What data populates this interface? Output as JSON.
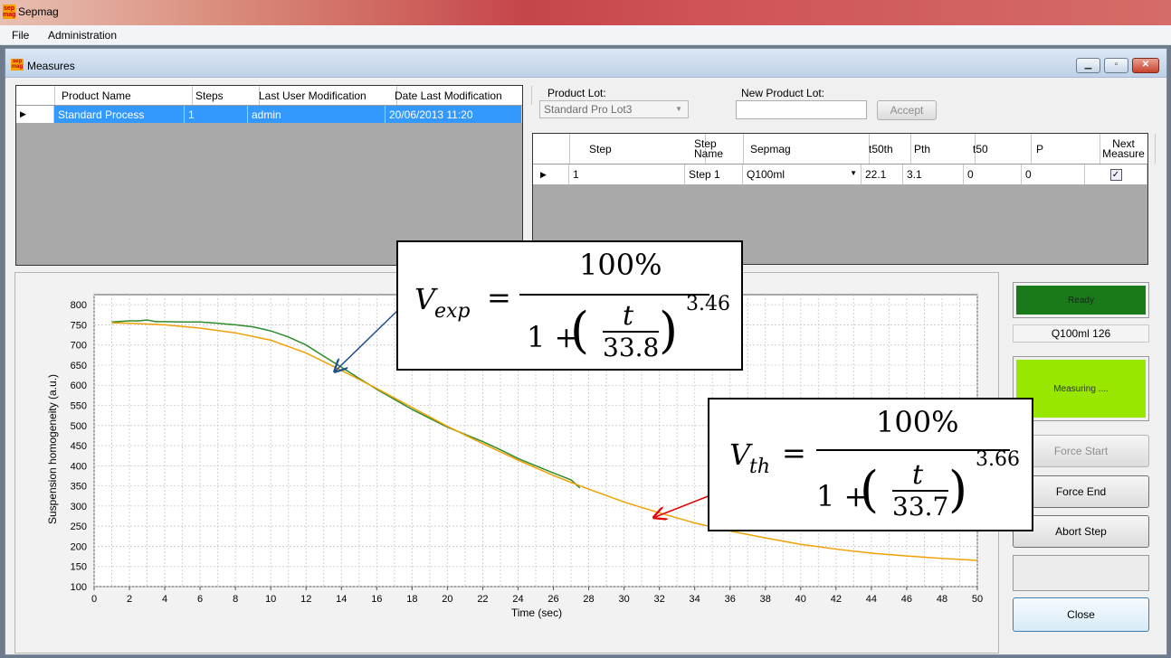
{
  "app": {
    "title": "Sepmag"
  },
  "menu": [
    {
      "label": "File"
    },
    {
      "label": "Administration"
    }
  ],
  "child_window": {
    "title": "Measures"
  },
  "product_table": {
    "columns": [
      "Product Name",
      "Steps",
      "Last User Modification",
      "Date Last Modification"
    ],
    "rows": [
      {
        "product_name": "Standard Process",
        "steps": "1",
        "last_user": "admin",
        "date": "20/06/2013 11:20"
      }
    ]
  },
  "product_lot": {
    "label": "Product Lot:",
    "value": "Standard Pro Lot3"
  },
  "new_product_lot": {
    "label": "New Product Lot:",
    "value": ""
  },
  "accept_label": "Accept",
  "step_table": {
    "columns": [
      "Step",
      "Step Name",
      "Sepmag",
      "t50th",
      "Pth",
      "t50",
      "P",
      "Next Measure"
    ],
    "rows": [
      {
        "step": "1",
        "step_name": "Step 1",
        "sepmag": "Q100ml",
        "t50th": "22.1",
        "pth": "3.1",
        "t50": "0",
        "p": "0",
        "next_measure": true
      }
    ]
  },
  "status": {
    "ready": "Ready",
    "device": "Q100ml 126",
    "measuring": "Measuring ...."
  },
  "buttons": {
    "force_start": "Force Start",
    "force_end": "Force End",
    "abort_step": "Abort Step",
    "close": "Close"
  },
  "colors": {
    "ready": "#1a7a1a",
    "measuring": "#99e600",
    "exp_series": "#2e8b2e",
    "th_series": "#f0a000",
    "arrow_exp": "#1f4e8c",
    "arrow_th": "#e00000",
    "selected_row": "#3399ff"
  },
  "chart_data": {
    "type": "line",
    "xlabel": "Time (sec)",
    "ylabel": "Suspension homogeneity (a.u.)",
    "xlim": [
      0,
      50
    ],
    "ylim": [
      100,
      825
    ],
    "xticks": [
      0,
      2,
      4,
      6,
      8,
      10,
      12,
      14,
      16,
      18,
      20,
      22,
      24,
      26,
      28,
      30,
      32,
      34,
      36,
      38,
      40,
      42,
      44,
      46,
      48,
      50
    ],
    "yticks": [
      100,
      150,
      200,
      250,
      300,
      350,
      400,
      450,
      500,
      550,
      600,
      650,
      700,
      750,
      800
    ],
    "grid": true,
    "series": [
      {
        "x": [
          1,
          2,
          2.5,
          3,
          3.5,
          4,
          5,
          6,
          7,
          8,
          9,
          10,
          11,
          12,
          13,
          14,
          15,
          16,
          17,
          18,
          19,
          20,
          21,
          22,
          23,
          24,
          25,
          26,
          27,
          27.5
        ],
        "y": [
          757,
          760,
          760,
          762,
          758,
          758,
          757,
          757,
          754,
          750,
          745,
          735,
          720,
          700,
          672,
          645,
          617,
          590,
          565,
          540,
          518,
          496,
          478,
          460,
          440,
          418,
          400,
          382,
          365,
          345
        ]
      },
      {
        "x": [
          1,
          2,
          4,
          6,
          8,
          10,
          12,
          14,
          16,
          18,
          20,
          22,
          24,
          26,
          28,
          30,
          32,
          34,
          36,
          38,
          40,
          42,
          44,
          46,
          48,
          50
        ],
        "y": [
          755,
          754,
          750,
          742,
          730,
          712,
          680,
          637,
          592,
          545,
          498,
          455,
          414,
          376,
          342,
          310,
          283,
          258,
          238,
          221,
          205,
          193,
          183,
          176,
          170,
          165
        ]
      }
    ]
  },
  "equation_exp": {
    "lhs": "V",
    "sub": "exp",
    "eq": "=",
    "num": "100%",
    "one": "1 +",
    "t": "t",
    "den": "33.8",
    "exp": "3.46"
  },
  "equation_th": {
    "lhs": "V",
    "sub": "th",
    "eq": "=",
    "num": "100%",
    "one": "1 +",
    "t": "t",
    "den": "33.7",
    "exp": "3.66"
  }
}
